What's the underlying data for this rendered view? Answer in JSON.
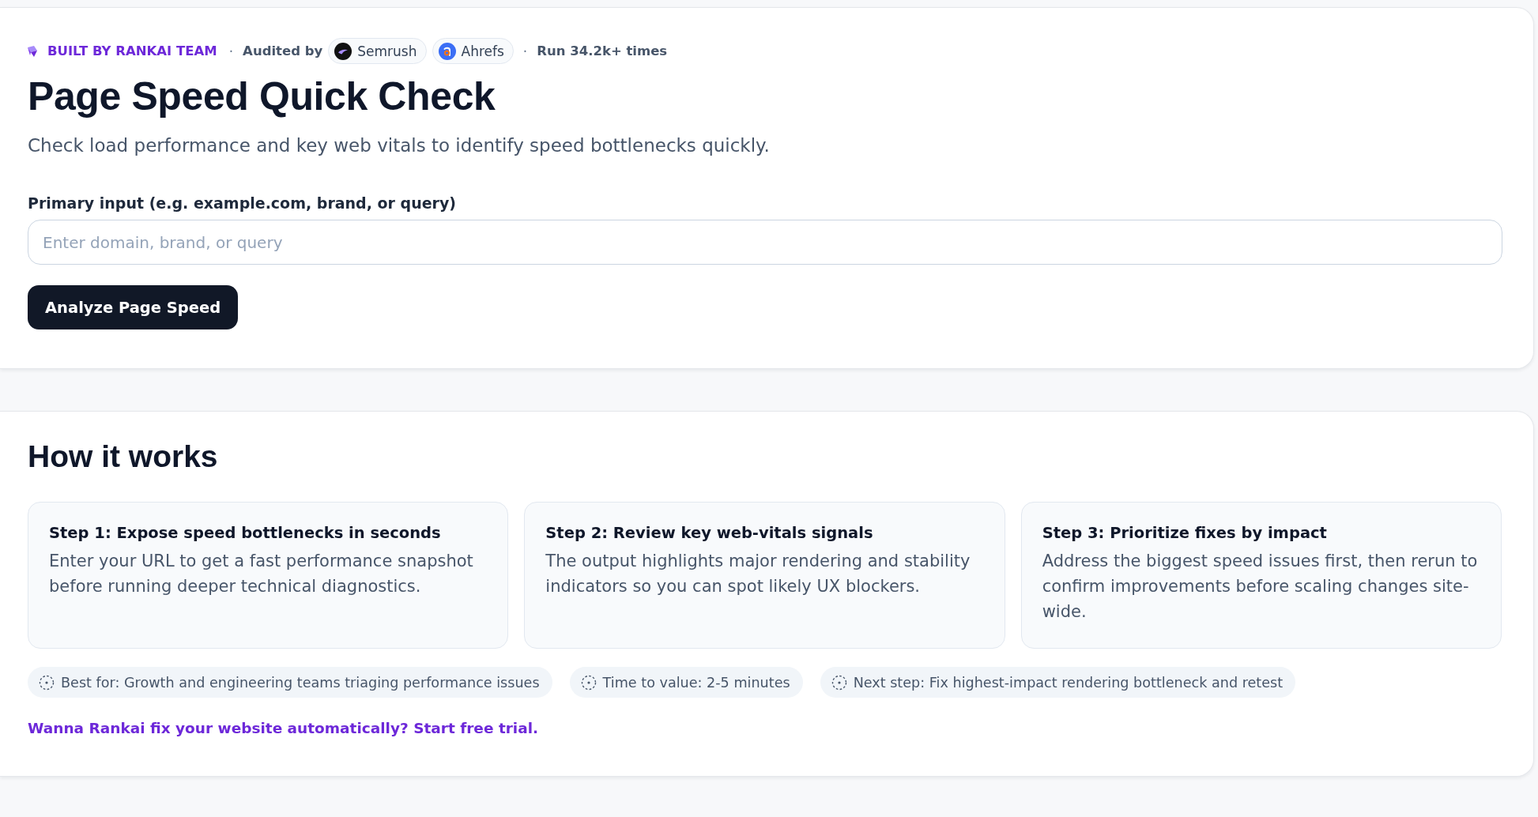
{
  "hero": {
    "meta": [
      {
        "kind": "brand",
        "text": "BUILT BY RANKAI TEAM"
      },
      {
        "kind": "separator",
        "text": "·"
      },
      {
        "kind": "label",
        "text": "Audited by"
      },
      {
        "kind": "auditor",
        "text": "Semrush"
      },
      {
        "kind": "auditor",
        "text": "Ahrefs"
      },
      {
        "kind": "separator",
        "text": "·"
      },
      {
        "kind": "label",
        "text": "Run 34.2k+ times"
      }
    ],
    "title": "Page Speed Quick Check",
    "subtitle": "Check load performance and key web vitals to identify speed bottlenecks quickly.",
    "input": {
      "label": "Primary input (e.g. example.com, brand, or query)",
      "placeholder": "Enter domain, brand, or query"
    },
    "button": "Analyze Page Speed"
  },
  "how_it_works": {
    "title": "How it works",
    "steps": [
      {
        "title": "Step 1: Expose speed bottlenecks in seconds",
        "description": "Enter your URL to get a fast performance snapshot before running deeper technical diagnostics."
      },
      {
        "title": "Step 2: Review key web-vitals signals",
        "description": "The output highlights major rendering and stability indicators so you can spot likely UX blockers."
      },
      {
        "title": "Step 3: Prioritize fixes by impact",
        "description": "Address the biggest speed issues first, then rerun to confirm improvements before scaling changes site-wide."
      }
    ],
    "tags": [
      "Best for: Growth and engineering teams triaging performance issues",
      "Time to value: 2-5 minutes",
      "Next step: Fix highest-impact rendering bottleneck and retest"
    ],
    "cta": "Wanna Rankai fix your website automatically? Start free trial."
  }
}
